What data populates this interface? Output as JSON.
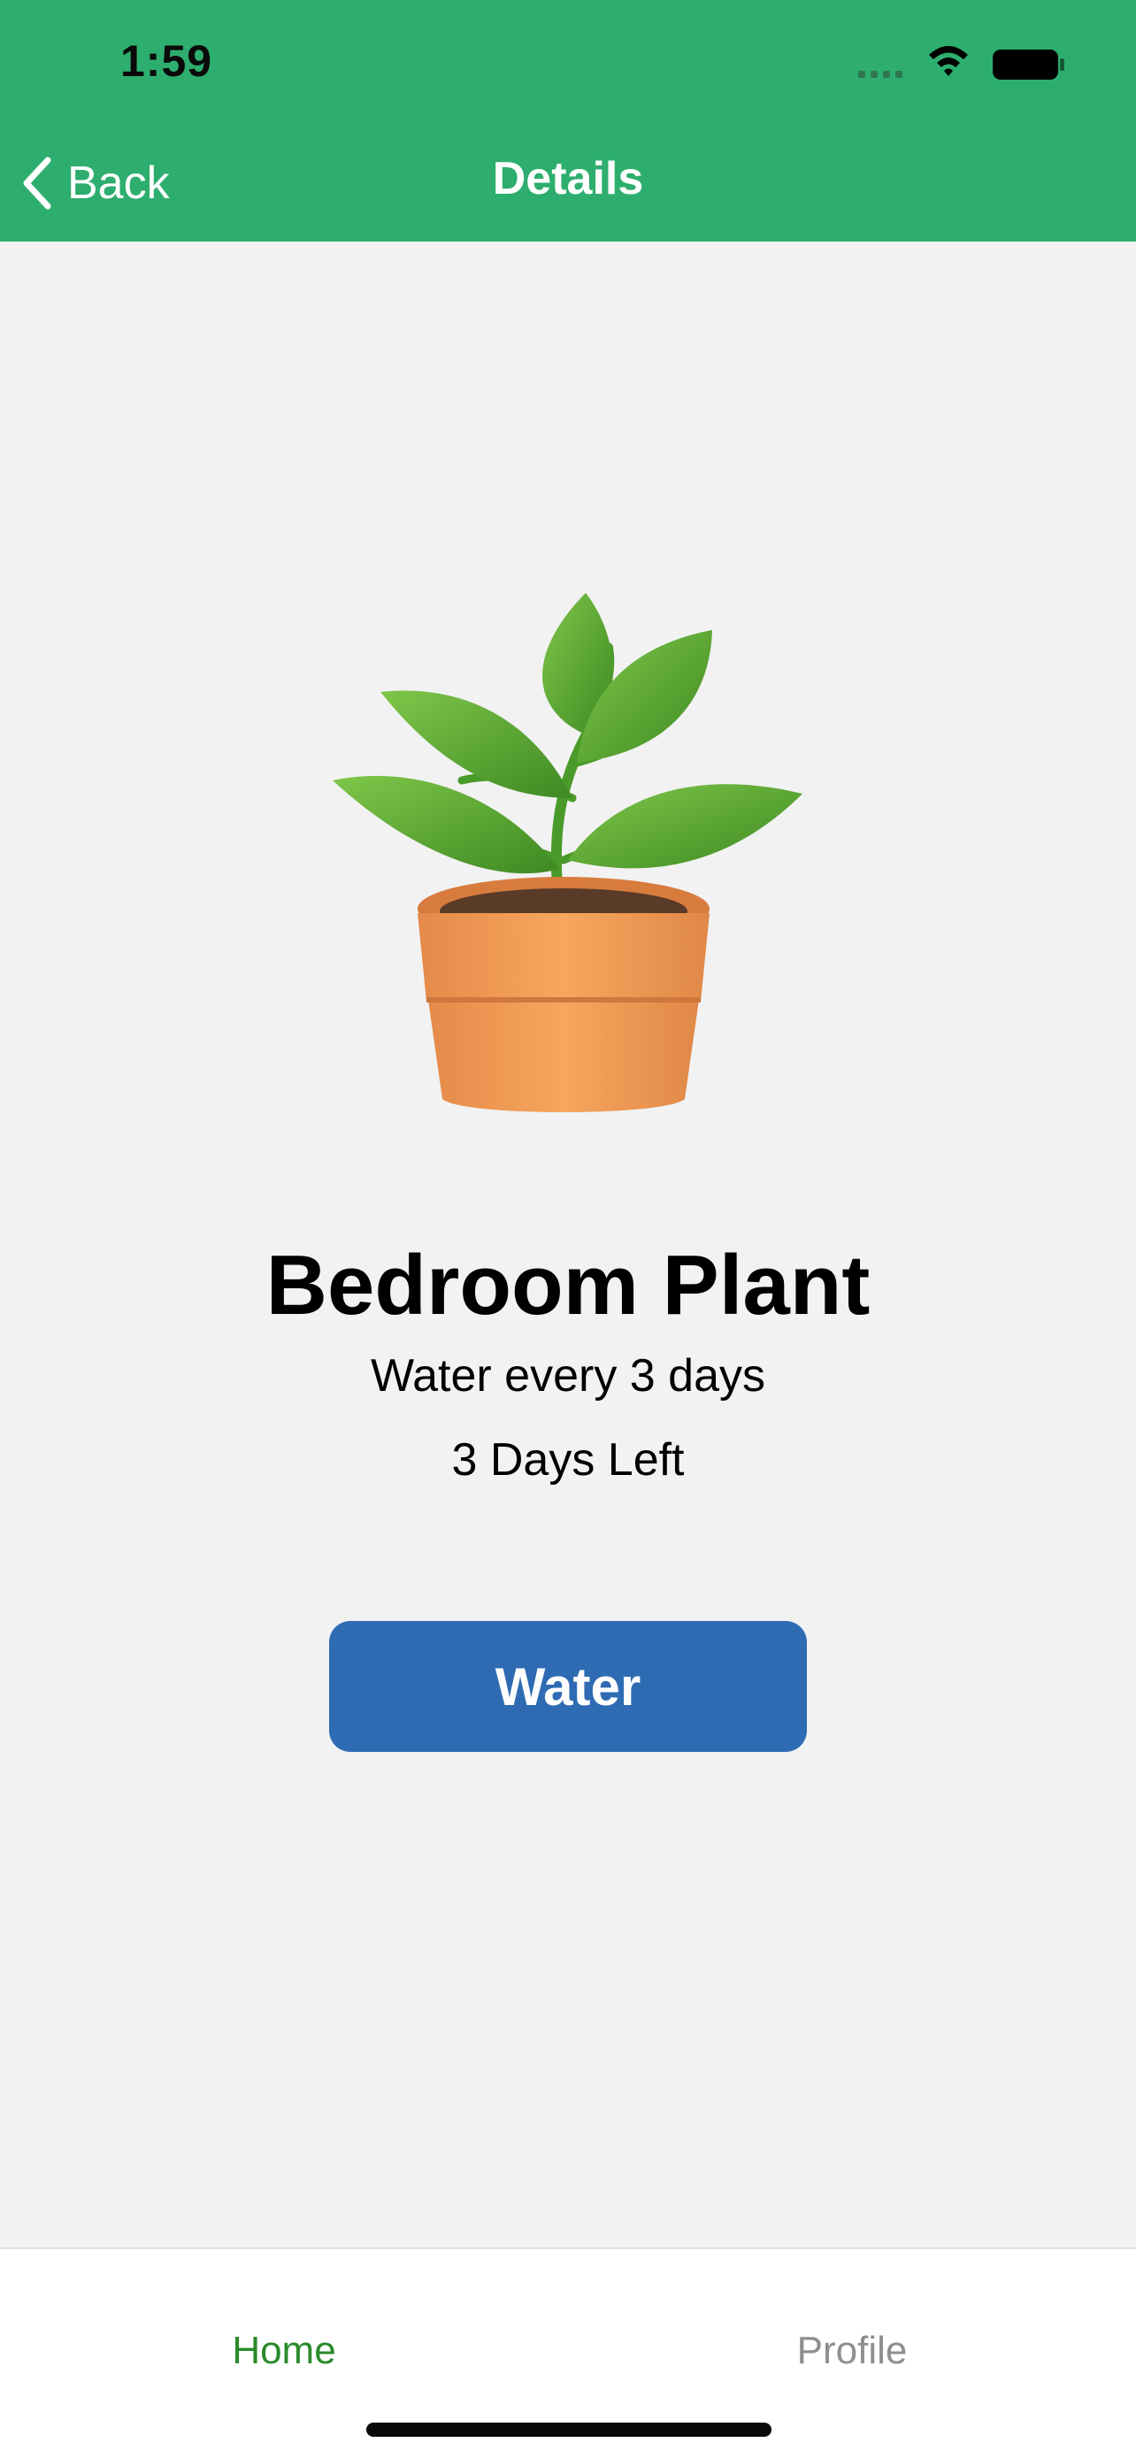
{
  "status_bar": {
    "time": "1:59"
  },
  "nav": {
    "back_label": "Back",
    "title": "Details"
  },
  "plant": {
    "icon": "potted-plant",
    "name": "Bedroom Plant",
    "schedule": "Water every 3 days",
    "days_left": "3 Days Left"
  },
  "actions": {
    "water_label": "Water"
  },
  "tabbar": {
    "tabs": [
      {
        "label": "Home",
        "active": true
      },
      {
        "label": "Profile",
        "active": false
      }
    ]
  },
  "colors": {
    "header": "#2eae6e",
    "background": "#f2f2f2",
    "water_button": "#2e6bb3",
    "tab_active": "#2a8a2a",
    "tab_inactive": "#8e8e8e"
  }
}
